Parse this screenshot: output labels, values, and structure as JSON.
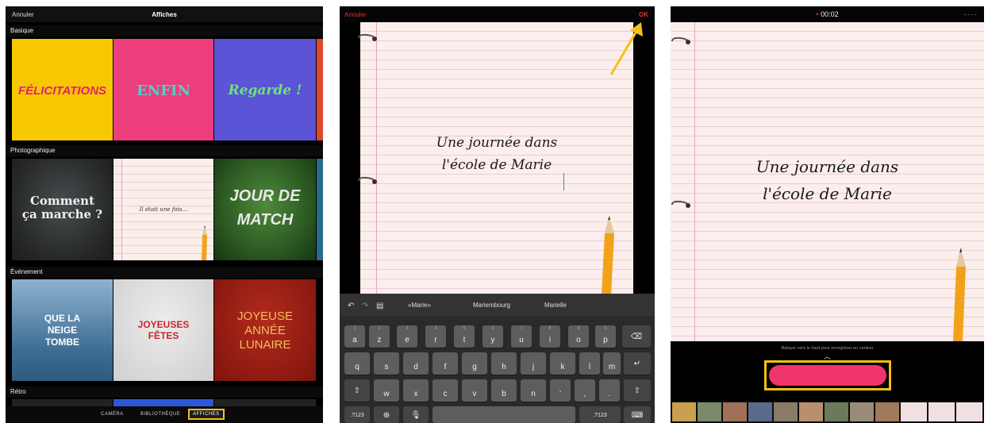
{
  "panel1": {
    "cancel": "Annuler",
    "title": "Affiches",
    "sections": [
      "Basique",
      "Photographique",
      "Événement",
      "Rétro"
    ],
    "basic": [
      "FÉLICITATIONS",
      "ENFIN",
      "Regarde !"
    ],
    "photo": {
      "chalk_1": "Comment",
      "chalk_2": "ça marche ?",
      "note": "Il était une fois…",
      "match_1": "JOUR DE",
      "match_2": "MATCH"
    },
    "event": {
      "snow_1": "QUE LA",
      "snow_2": "NEIGE",
      "snow_3": "TOMBE",
      "fetes_1": "JOYEUSES",
      "fetes_2": "FÊTES",
      "lunar_1": "JOYEUSE",
      "lunar_2": "ANNÉE",
      "lunar_3": "LUNAIRE"
    },
    "tabs": {
      "camera": "CAMÉRA",
      "library": "BIBLIOTHÈQUE",
      "posters": "AFFICHES"
    }
  },
  "panel2": {
    "cancel": "Annuler",
    "ok": "OK",
    "text_line1": "Une journée dans",
    "text_line2": "l'école de Marie",
    "suggestions": [
      "«Marie»",
      "Mariembourg",
      "Marielle"
    ],
    "keys": {
      "row1": [
        "a",
        "z",
        "e",
        "r",
        "t",
        "y",
        "u",
        "i",
        "o",
        "p"
      ],
      "row2": [
        "q",
        "s",
        "d",
        "f",
        "g",
        "h",
        "j",
        "k",
        "l",
        "m"
      ],
      "row3": [
        "w",
        "x",
        "c",
        "v",
        "b",
        "n",
        "’",
        ",",
        "."
      ],
      "numbers": ".?123"
    }
  },
  "panel3": {
    "time": "00:02",
    "text_line1": "Une journée dans",
    "text_line2": "l'école de Marie",
    "hint": "Balayer vers le haut pour enregistrer en continu"
  },
  "colors": {
    "accent_red": "#e0313a",
    "highlight_yellow": "#f3c118",
    "record_pink": "#f0356a"
  }
}
